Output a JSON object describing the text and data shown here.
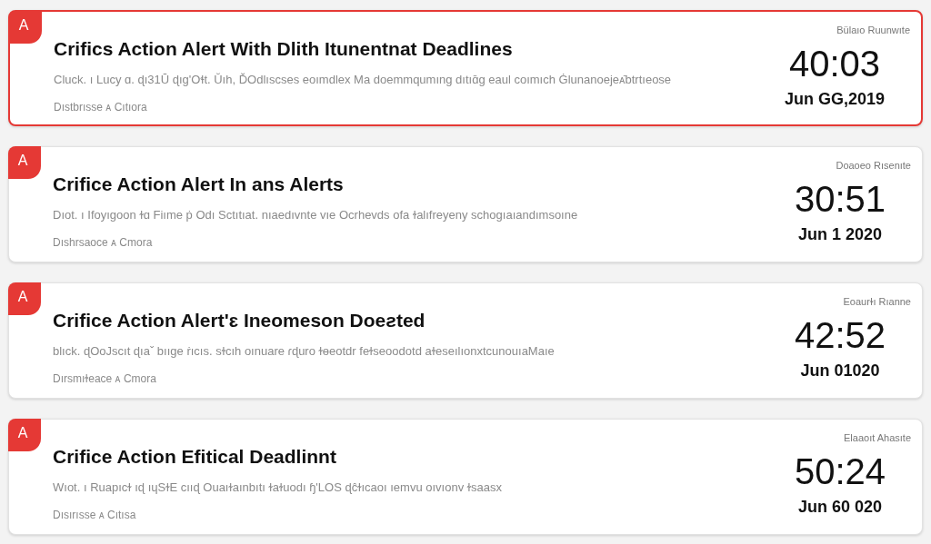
{
  "alerts": [
    {
      "badge": "A",
      "title": "Crifics Action Alert With Dlith Itunentnat Deadlines",
      "description": "Cluck. ı Lucy ɑ. ɖı31Ū ɖıɡ'Oɬt. Ŭıh, ĎOdlıscses eoımdlex Ma doemmqumıng dıtıɑ̄ɡ eaul coımıch Ġlunanoejeᴀ̄btrtıeose",
      "meta": "Dıstbrısse ᴀ Cıtıora",
      "label": "Bülaıo Ruunwıte",
      "time": "40:03",
      "date": "Jun GG,2019",
      "selected": true
    },
    {
      "badge": "A",
      "title": "Crifice Action Alert In ans Alerts",
      "description": "Dıot. ı Ifoyıgoon ɫɑ Fiıme ṗ Odı Sctıtıat. nıaedıvnte vıe Ocrhevds ofa ɫalıfreyeny schoɡıaıandımsoıne",
      "meta": "Dıshrsaoce ᴀ Cmora",
      "label": "Doaoeo Rısenıte",
      "time": "30:51",
      "date": "Jun 1 2020",
      "selected": false
    },
    {
      "badge": "A",
      "title": "Crifice Action Alert'ɛ Ineomeson Doeƨted",
      "description": "blıck. ɖOoJscıt ɖıaˇ bııɡe ṙıcıs. sɫcıh oınuare ɾɖuro ɫɵeotdr feɫseoodotd aɫeseılıonxtcunouıaMaıe",
      "meta": "Dırsmıɫeace ᴀ Cmora",
      "label": "Eoaurɫı Rıanne",
      "time": "42:52",
      "date": "Jun 01020",
      "selected": false
    },
    {
      "badge": "A",
      "title": "Crifice Action Efitical Deadlinnt",
      "description": "Wıot. ı Ruapıcɫ ıɖ ıɥSɫE cııɖ Ouaıɫaınbıtı ɫaɫuodı ɧ'LOS ɖĉɫıcaoı ıemvu oıvıonv ɫsaasx",
      "meta": "Dısırısse ᴀ Cıtısa",
      "label": "Elaaoıt Ahasıte",
      "time": "50:24",
      "date": "Jun 60 020",
      "selected": false
    }
  ]
}
